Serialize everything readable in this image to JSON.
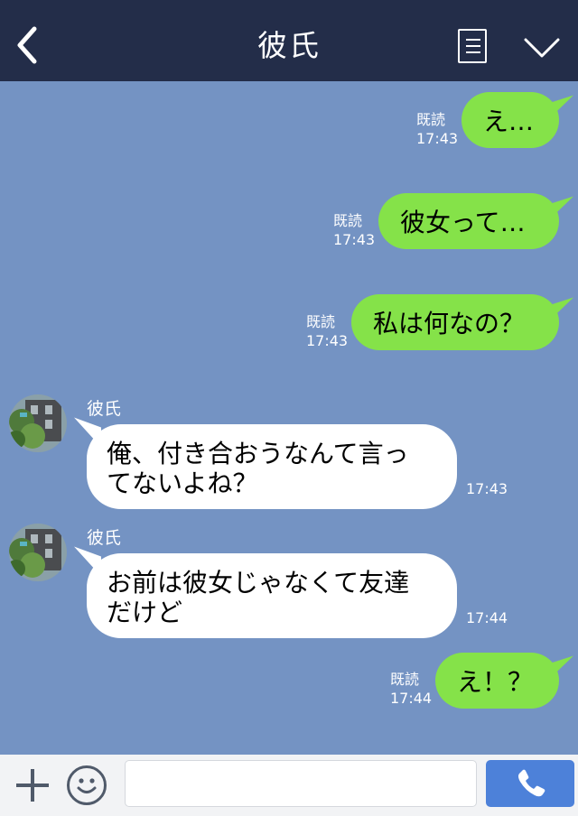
{
  "header": {
    "title": "彼氏",
    "back_icon": "chevron-left-icon",
    "list_icon": "document-list-icon",
    "expand_icon": "chevron-down-icon"
  },
  "messages": [
    {
      "direction": "sent",
      "text": "え…",
      "read": "既読",
      "time": "17:43"
    },
    {
      "direction": "sent",
      "text": "彼女って…",
      "read": "既読",
      "time": "17:43"
    },
    {
      "direction": "sent",
      "text": "私は何なの？",
      "read": "既読",
      "time": "17:43"
    },
    {
      "direction": "received",
      "sender": "彼氏",
      "lines": [
        "俺、付き合おうなんて言っ",
        "てないよね？"
      ],
      "time": "17:43"
    },
    {
      "direction": "received",
      "sender": "彼氏",
      "lines": [
        "お前は彼女じゃなくて友達",
        "だけど"
      ],
      "time": "17:44"
    },
    {
      "direction": "sent",
      "text": "え！？",
      "read": "既読",
      "time": "17:44"
    }
  ],
  "input_bar": {
    "plus_icon": "plus-icon",
    "emoji_icon": "smiley-icon",
    "message_value": "",
    "call_icon": "phone-icon"
  },
  "colors": {
    "header_bg": "#232d49",
    "chat_bg": "#7493c3",
    "sent_bubble": "#85e249",
    "received_bubble": "#ffffff",
    "call_button": "#4d81d9"
  }
}
